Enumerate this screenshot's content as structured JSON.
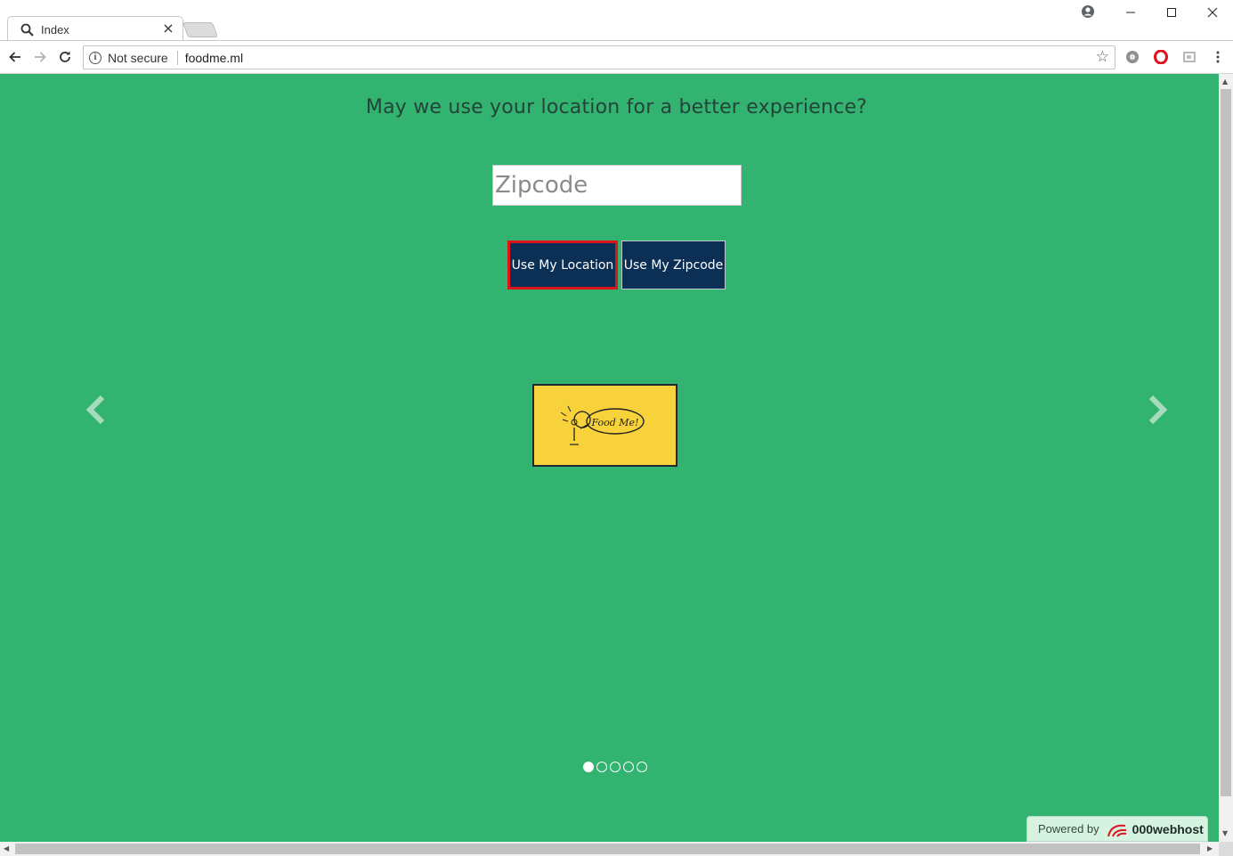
{
  "browser": {
    "tab_title": "Index",
    "tab_close": "×",
    "security_label": "Not secure",
    "url": "foodme.ml"
  },
  "page": {
    "prompt": "May we use your location for a better experience?",
    "zipcode_placeholder": "Zipcode",
    "zipcode_value": "",
    "use_location_label": "Use My Location",
    "use_zipcode_label": "Use My Zipcode",
    "logo_text": "Food Me!",
    "carousel": {
      "slide_count": 5,
      "active_index": 0
    },
    "powered_by_label": "Powered by",
    "powered_by_brand": "000webhost"
  },
  "colors": {
    "page_bg": "#32b370",
    "button_bg": "#0b2f55",
    "focus_outline": "#e0121b",
    "logo_bg": "#f8d23a"
  },
  "icons": [
    "search-icon",
    "close-icon",
    "profile-icon",
    "minimize-icon",
    "maximize-icon",
    "window-close-icon",
    "back-arrow-icon",
    "forward-arrow-icon",
    "reload-icon",
    "info-icon",
    "bookmark-star-icon",
    "extension-icon",
    "opera-icon",
    "cast-icon",
    "menu-dots-icon",
    "chevron-left-icon",
    "chevron-right-icon",
    "webhost-logo-icon"
  ]
}
